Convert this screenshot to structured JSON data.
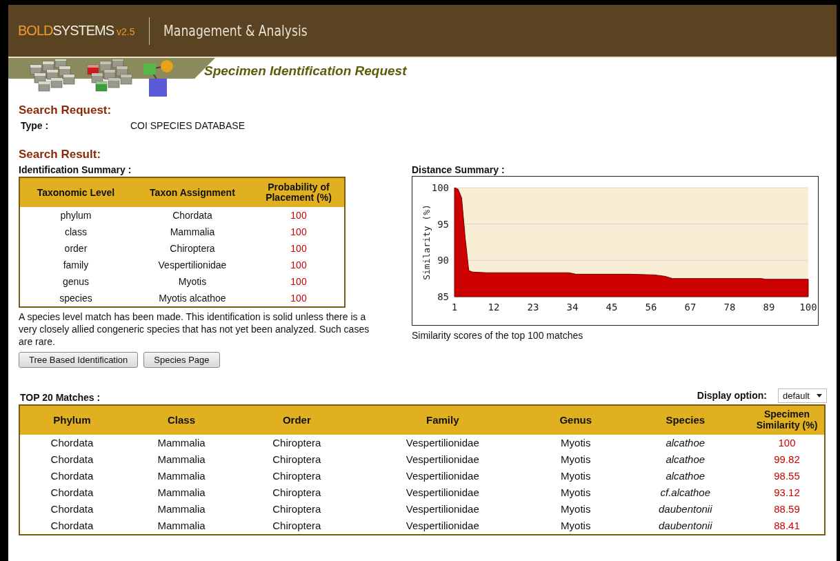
{
  "header": {
    "logo_bold": "BOLD",
    "logo_systems": "SYSTEMS",
    "logo_version": "v2.5",
    "section": "Management & Analysis"
  },
  "page_title": "Specimen Identification Request",
  "search_request": {
    "heading": "Search Request:",
    "type_label": "Type :",
    "type_value": "COI SPECIES DATABASE"
  },
  "search_result": {
    "heading": "Search Result:"
  },
  "identification_summary": {
    "title": "Identification Summary :",
    "columns": [
      "Taxonomic Level",
      "Taxon Assignment",
      "Probability of Placement (%)"
    ],
    "rows": [
      [
        "phylum",
        "Chordata",
        "100"
      ],
      [
        "class",
        "Mammalia",
        "100"
      ],
      [
        "order",
        "Chiroptera",
        "100"
      ],
      [
        "family",
        "Vespertilionidae",
        "100"
      ],
      [
        "genus",
        "Myotis",
        "100"
      ],
      [
        "species",
        "Myotis alcathoe",
        "100"
      ]
    ],
    "note": "A species level match has been made. This identification is solid unless there is a very closely allied congeneric species that has not yet been analyzed. Such cases are rare.",
    "buttons": [
      "Tree Based Identification",
      "Species Page"
    ]
  },
  "distance_summary": {
    "title": "Distance Summary :",
    "caption": "Similarity scores of the top 100 matches",
    "chart_data": {
      "type": "area",
      "ylabel": "Similarity (%)",
      "x": [
        1,
        2,
        3,
        4,
        5,
        6,
        10,
        33,
        35,
        50,
        57,
        60,
        62,
        87,
        88,
        100
      ],
      "series": [
        {
          "color": "#cc0000",
          "values": [
            100,
            99.8,
            98.6,
            93.1,
            88.6,
            88.4,
            88.3,
            88.3,
            88.1,
            88.1,
            88.0,
            87.8,
            87.5,
            87.5,
            87.4,
            87.4
          ]
        }
      ],
      "xlim": [
        1,
        100
      ],
      "ylim": [
        85,
        100
      ],
      "xticks": [
        1,
        12,
        23,
        34,
        45,
        56,
        67,
        78,
        89,
        100
      ],
      "yticks": [
        85,
        90,
        95,
        100
      ]
    }
  },
  "top_matches": {
    "title": "TOP 20 Matches :",
    "display_option_label": "Display option:",
    "display_option_value": "default",
    "columns": [
      "Phylum",
      "Class",
      "Order",
      "Family",
      "Genus",
      "Species",
      "Specimen Similarity (%)"
    ],
    "rows": [
      [
        "Chordata",
        "Mammalia",
        "Chiroptera",
        "Vespertilionidae",
        "Myotis",
        "alcathoe",
        "100"
      ],
      [
        "Chordata",
        "Mammalia",
        "Chiroptera",
        "Vespertilionidae",
        "Myotis",
        "alcathoe",
        "99.82"
      ],
      [
        "Chordata",
        "Mammalia",
        "Chiroptera",
        "Vespertilionidae",
        "Myotis",
        "alcathoe",
        "98.55"
      ],
      [
        "Chordata",
        "Mammalia",
        "Chiroptera",
        "Vespertilionidae",
        "Myotis",
        "cf.alcathoe",
        "93.12"
      ],
      [
        "Chordata",
        "Mammalia",
        "Chiroptera",
        "Vespertilionidae",
        "Myotis",
        "daubentonii",
        "88.59"
      ],
      [
        "Chordata",
        "Mammalia",
        "Chiroptera",
        "Vespertilionidae",
        "Myotis",
        "daubentonii",
        "88.41"
      ]
    ]
  }
}
